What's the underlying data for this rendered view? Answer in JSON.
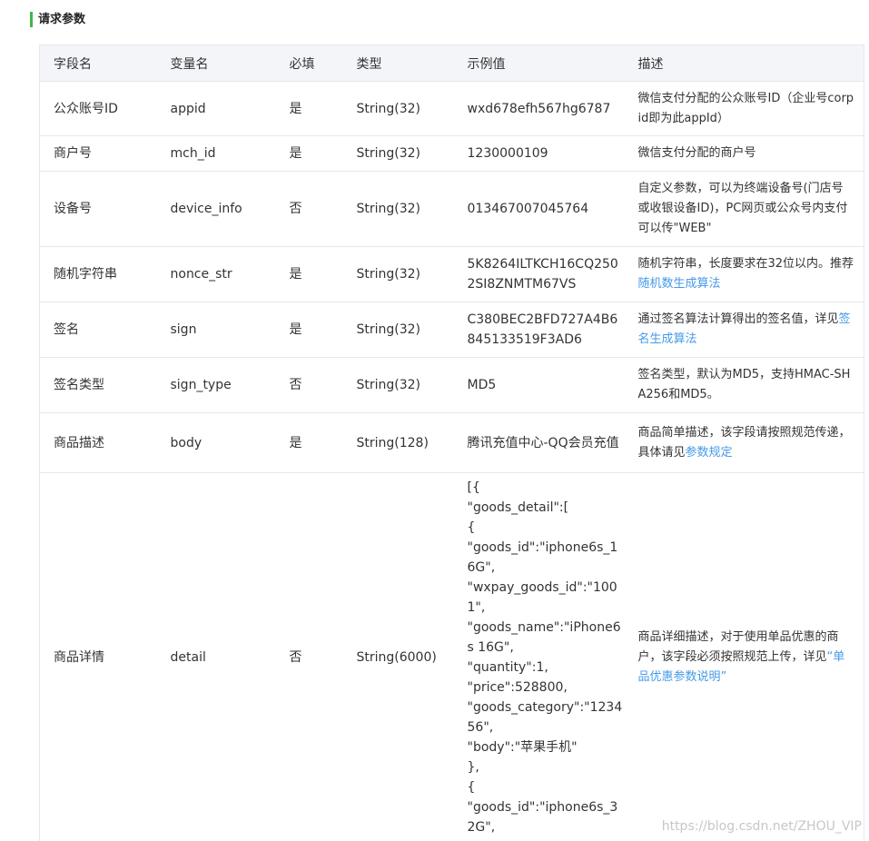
{
  "section": {
    "title": "请求参数"
  },
  "table": {
    "headers": [
      "字段名",
      "变量名",
      "必填",
      "类型",
      "示例值",
      "描述"
    ],
    "rows": [
      {
        "field": "公众账号ID",
        "var": "appid",
        "required": "是",
        "type": "String(32)",
        "example": "wxd678efh567hg6787",
        "desc": "微信支付分配的公众账号ID（企业号corpid即为此appId）",
        "desc_link": ""
      },
      {
        "field": "商户号",
        "var": "mch_id",
        "required": "是",
        "type": "String(32)",
        "example": "1230000109",
        "desc": "微信支付分配的商户号",
        "desc_link": ""
      },
      {
        "field": "设备号",
        "var": "device_info",
        "required": "否",
        "type": "String(32)",
        "example": "013467007045764",
        "desc": "自定义参数，可以为终端设备号(门店号或收银设备ID)，PC网页或公众号内支付可以传\"WEB\"",
        "desc_link": ""
      },
      {
        "field": "随机字符串",
        "var": "nonce_str",
        "required": "是",
        "type": "String(32)",
        "example": "5K8264ILTKCH16CQ2502SI8ZNMTM67VS",
        "desc": "随机字符串，长度要求在32位以内。推荐",
        "desc_link": "随机数生成算法"
      },
      {
        "field": "签名",
        "var": "sign",
        "required": "是",
        "type": "String(32)",
        "example": "C380BEC2BFD727A4B6845133519F3AD6",
        "desc": "通过签名算法计算得出的签名值，详见",
        "desc_link": "签名生成算法"
      },
      {
        "field": "签名类型",
        "var": "sign_type",
        "required": "否",
        "type": "String(32)",
        "example": "MD5",
        "desc": "签名类型，默认为MD5，支持HMAC-SHA256和MD5。",
        "desc_link": ""
      },
      {
        "field": "商品描述",
        "var": "body",
        "required": "是",
        "type": "String(128)",
        "example": "腾讯充值中心-QQ会员充值",
        "desc": "商品简单描述，该字段请按照规范传递，具体请见",
        "desc_link": "参数规定"
      },
      {
        "field": "商品详情",
        "var": "detail",
        "required": "否",
        "type": "String(6000)",
        "example": "[{\n\"goods_detail\":[\n{\n\"goods_id\":\"iphone6s_16G\",\n\"wxpay_goods_id\":\"1001\",\n\"goods_name\":\"iPhone6s 16G\",\n\"quantity\":1,\n\"price\":528800,\n\"goods_category\":\"123456\",\n\"body\":\"苹果手机\"\n},\n{\n\"goods_id\":\"iphone6s_32G\",",
        "desc": "商品详细描述，对于使用单品优惠的商户，该字段必须按照规范上传，详见",
        "desc_link": "“单品优惠参数说明”"
      }
    ]
  },
  "watermark": "https://blog.csdn.net/ZHOU_VIP"
}
